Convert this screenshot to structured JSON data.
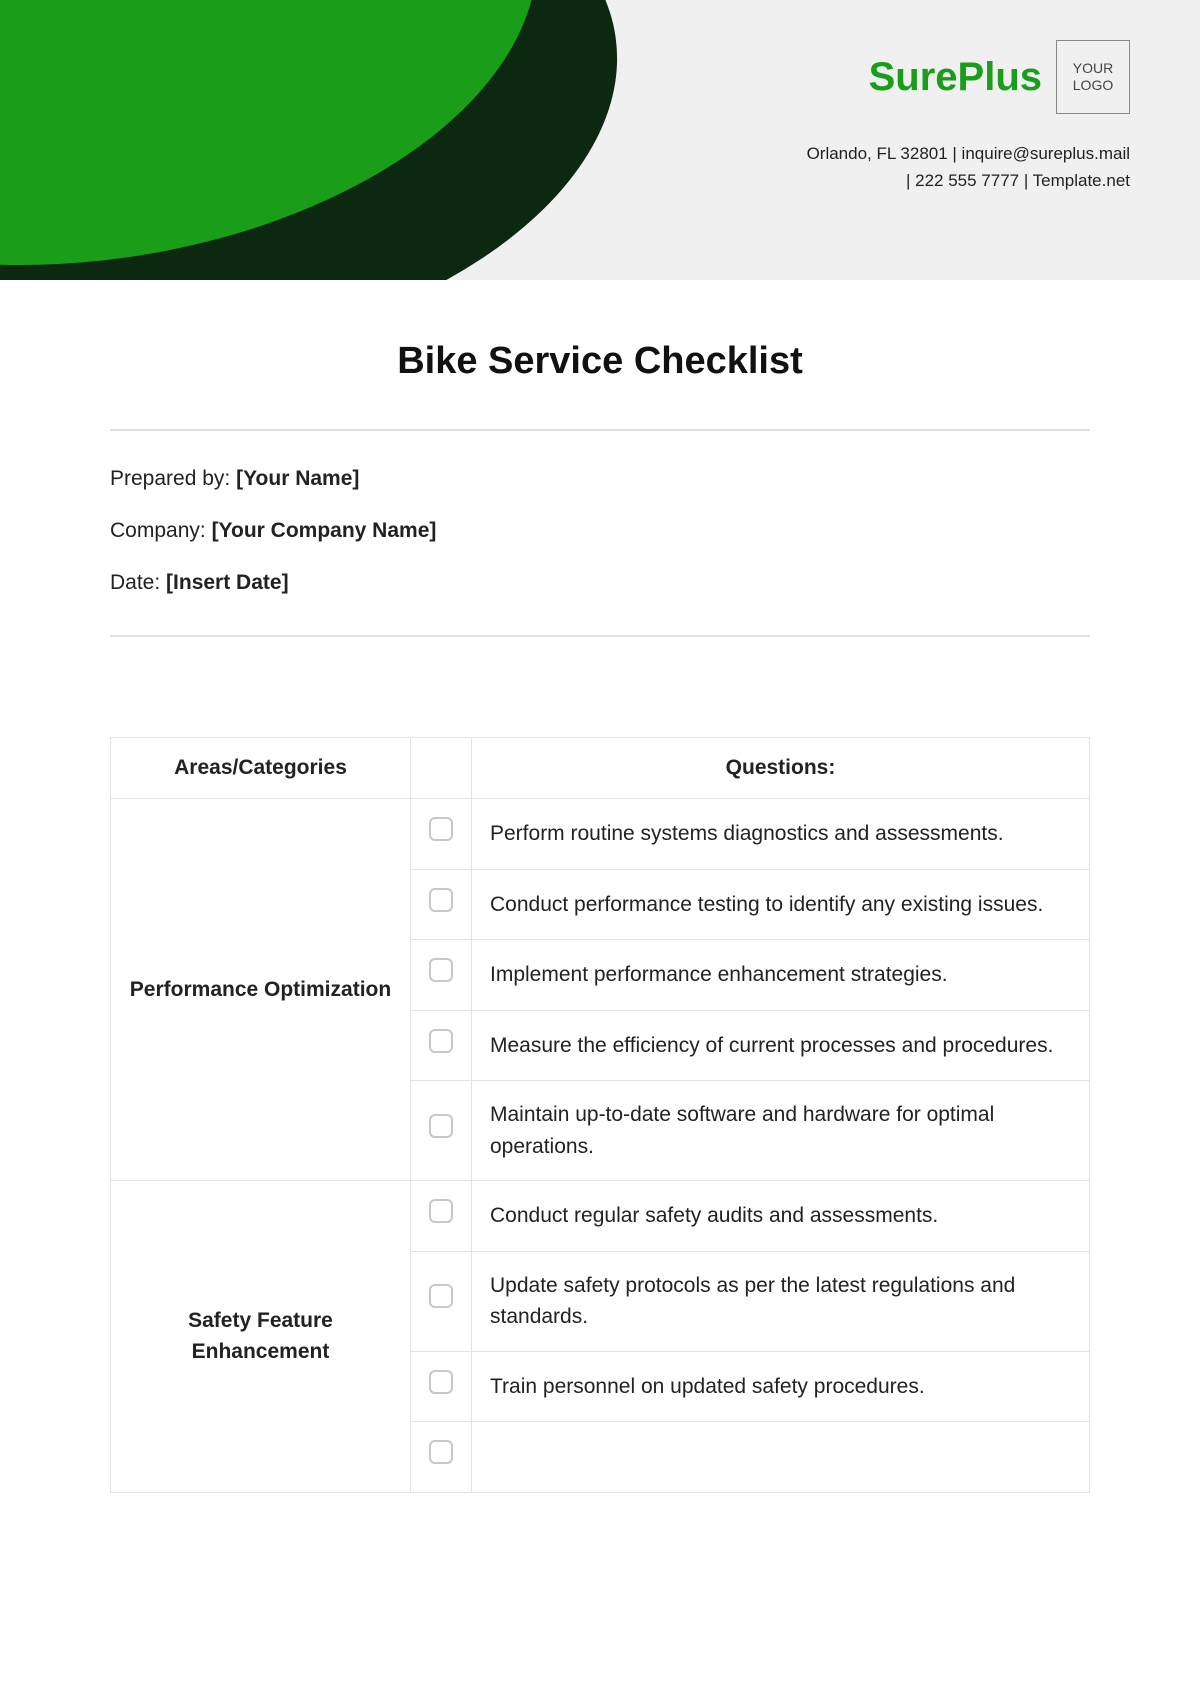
{
  "brand": {
    "name": "SurePlus",
    "logo_placeholder": "YOUR LOGO"
  },
  "contact": {
    "line1": "Orlando, FL 32801 | inquire@sureplus.mail",
    "line2": "| 222 555 7777 | Template.net"
  },
  "title": "Bike Service Checklist",
  "meta": {
    "prepared_label": "Prepared by:",
    "prepared_value": "[Your Name]",
    "company_label": "Company:",
    "company_value": "[Your Company Name]",
    "date_label": "Date:",
    "date_value": "[Insert Date]"
  },
  "table": {
    "col_areas": "Areas/Categories",
    "col_questions": "Questions:",
    "sections": [
      {
        "category": "Performance Optimization",
        "items": [
          "Perform routine systems diagnostics and assessments.",
          "Conduct performance testing to identify any existing issues.",
          "Implement performance enhancement strategies.",
          "Measure the efficiency of current processes and procedures.",
          "Maintain up-to-date software and hardware for optimal operations."
        ]
      },
      {
        "category": "Safety Feature Enhancement",
        "items": [
          "Conduct regular safety audits and assessments.",
          "Update safety protocols as per the latest regulations and standards.",
          "Train personnel on updated safety procedures.",
          ""
        ]
      }
    ]
  }
}
